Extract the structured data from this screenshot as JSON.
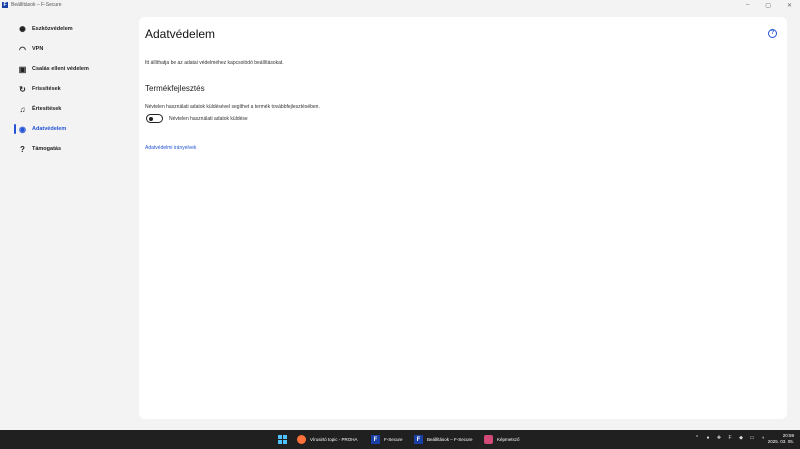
{
  "window": {
    "title": "Beállítások – F-Secure",
    "app_icon": "F",
    "minimize_icon": "minimize-icon",
    "maximize_icon": "maximize-icon",
    "close_icon": "close-icon"
  },
  "sidebar": {
    "items": [
      {
        "label": "Eszközvédelem",
        "icon": "bug-icon",
        "glyph": "✺"
      },
      {
        "label": "VPN",
        "icon": "vpn-icon",
        "glyph": "◠"
      },
      {
        "label": "Csalás elleni védelem",
        "icon": "wallet-icon",
        "glyph": "▣"
      },
      {
        "label": "Frissítések",
        "icon": "refresh-icon",
        "glyph": "↻"
      },
      {
        "label": "Értesítések",
        "icon": "bell-icon",
        "glyph": "♫"
      },
      {
        "label": "Adatvédelem",
        "icon": "eye-slash-icon",
        "glyph": "◉",
        "active": true
      },
      {
        "label": "Támogatás",
        "icon": "question-icon",
        "glyph": "?"
      }
    ]
  },
  "main": {
    "title": "Adatvédelem",
    "help_glyph": "?",
    "intro": "Itt állíthatja be az adatai védelméhez kapcsolódó beállításokat.",
    "section_title": "Termékfejlesztés",
    "section_desc": "Névtelen használati adatok küldésével segíthet a termék továbbfejlesztésében.",
    "toggle": {
      "label": "Névtelen használati adatok küldése",
      "on": false
    },
    "link": "Adatvédelmi irányelvek"
  },
  "taskbar": {
    "items": [
      {
        "label": "",
        "icon": "windows-start-icon"
      },
      {
        "label": "Vírusirtó topic - PROHA",
        "icon": "firefox-icon"
      },
      {
        "label": "F-Secure",
        "icon": "fsecure-icon"
      },
      {
        "label": "Beállítások – F-Secure",
        "icon": "fsecure-icon"
      },
      {
        "label": "Képmetsző",
        "icon": "snipping-tool-icon"
      }
    ],
    "clock_time": "20:59",
    "clock_date": "2025. 03. 05."
  }
}
